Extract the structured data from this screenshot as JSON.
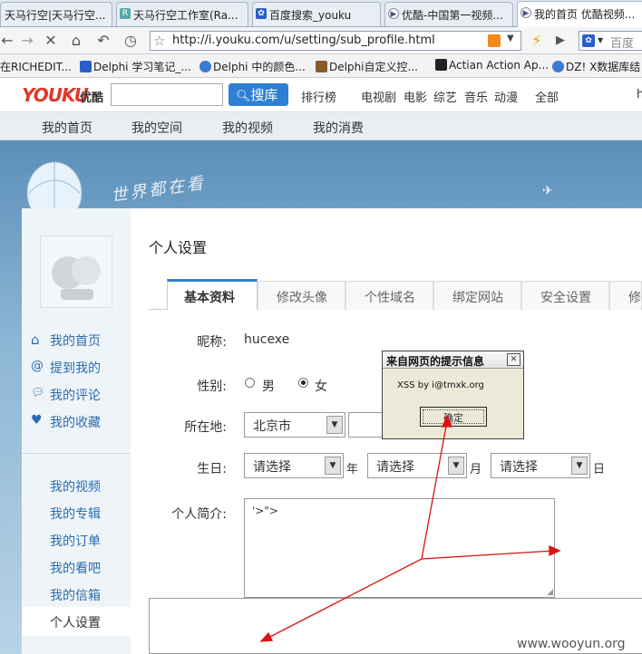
{
  "browser": {
    "tabs": [
      {
        "label": "天马行空|天马行空..."
      },
      {
        "label": "天马行空工作室(Ra..."
      },
      {
        "label": "百度搜索_youku"
      },
      {
        "label": "优酷-中国第一视频..."
      },
      {
        "label": "我的首页 优酷视频..."
      }
    ],
    "url": "http://i.youku.com/u/setting/sub_profile.html",
    "search_placeholder": "百度",
    "bookmarks": [
      {
        "label": "在RICHEDIT..."
      },
      {
        "label": "Delphi 学习笔记_..."
      },
      {
        "label": "Delphi 中的颜色..."
      },
      {
        "label": "Delphi自定义控..."
      },
      {
        "label": "Actian Action Ap..."
      },
      {
        "label": "DZ! X数据库结"
      }
    ]
  },
  "youku": {
    "logo": "YOUKU",
    "logo_cn": "优酷",
    "search_button": "搜库",
    "nav": [
      "排行榜",
      "电视剧",
      "电影",
      "综艺",
      "音乐",
      "动漫",
      "全部",
      "h"
    ],
    "subnav": [
      "我的首页",
      "我的空间",
      "我的视频",
      "我的消费"
    ],
    "banner_text": "世界都在看"
  },
  "sidebar": {
    "top_links": [
      "我的首页",
      "提到我的",
      "我的评论",
      "我的收藏"
    ],
    "bottom_links": [
      "我的视频",
      "我的专辑",
      "我的订单",
      "我的看吧",
      "我的信箱",
      "个人设置"
    ]
  },
  "settings": {
    "title": "个人设置",
    "tabs": [
      "基本资料",
      "修改头像",
      "个性域名",
      "绑定网站",
      "安全设置",
      "修i"
    ],
    "nickname_label": "昵称:",
    "nickname_value": "hucexe",
    "gender_label": "性别:",
    "gender_male": "男",
    "gender_female": "女",
    "location_label": "所在地:",
    "location_value": "北京市",
    "birthday_label": "生日:",
    "birthday_select": "请选择",
    "year": "年",
    "month": "月",
    "day": "日",
    "bio_label": "个人简介:",
    "bio_value": "'>\">"
  },
  "dialog": {
    "title": "来自网页的提示信息",
    "close": "✕",
    "message": "XSS by i@tmxk.org",
    "ok": "确定"
  },
  "watermark": "www.wooyun.org"
}
